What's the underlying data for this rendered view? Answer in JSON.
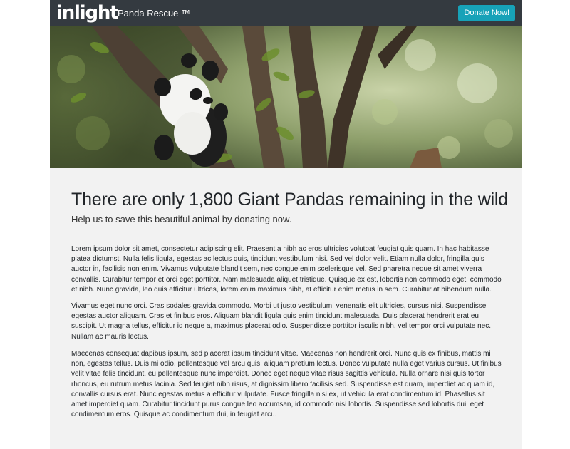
{
  "navbar": {
    "logo_text": "inlight",
    "brand": "Panda Rescue ™",
    "donate_label": "Donate Now!"
  },
  "hero": {
    "image_description": "panda-in-tree"
  },
  "main": {
    "headline": "There are only 1,800 Giant Pandas remaining in the wild",
    "subheadline": "Help us to save this beautiful animal by donating now.",
    "paragraphs": [
      "Lorem ipsum dolor sit amet, consectetur adipiscing elit. Praesent a nibh ac eros ultricies volutpat feugiat quis quam. In hac habitasse platea dictumst. Nulla felis ligula, egestas ac lectus quis, tincidunt vestibulum nisi. Sed vel dolor velit. Etiam nulla dolor, fringilla quis auctor in, facilisis non enim. Vivamus vulputate blandit sem, nec congue enim scelerisque vel. Sed pharetra neque sit amet viverra convallis. Curabitur tempor et orci eget porttitor. Nam malesuada aliquet tristique. Quisque ex est, lobortis non commodo eget, commodo et nibh. Nunc gravida, leo quis efficitur ultrices, lorem enim maximus nibh, at efficitur enim metus in sem. Curabitur at bibendum nulla.",
      "Vivamus eget nunc orci. Cras sodales gravida commodo. Morbi ut justo vestibulum, venenatis elit ultricies, cursus nisi. Suspendisse egestas auctor aliquam. Cras et finibus eros. Aliquam blandit ligula quis enim tincidunt malesuada. Duis placerat hendrerit erat eu suscipit. Ut magna tellus, efficitur id neque a, maximus placerat odio. Suspendisse porttitor iaculis nibh, vel tempor orci vulputate nec. Nullam ac mauris lectus.",
      "Maecenas consequat dapibus ipsum, sed placerat ipsum tincidunt vitae. Maecenas non hendrerit orci. Nunc quis ex finibus, mattis mi non, egestas tellus. Duis mi odio, pellentesque vel arcu quis, aliquam pretium lectus. Donec vulputate nulla eget varius cursus. Ut finibus velit vitae felis tincidunt, eu pellentesque nunc imperdiet. Donec eget neque vitae risus sagittis vehicula. Nulla ornare nisi quis tortor rhoncus, eu rutrum metus lacinia. Sed feugiat nibh risus, at dignissim libero facilisis sed. Suspendisse est quam, imperdiet ac quam id, convallis cursus erat. Nunc egestas metus a efficitur vulputate. Fusce fringilla nisi ex, ut vehicula erat condimentum id. Phasellus sit amet imperdiet quam. Curabitur tincidunt purus congue leo accumsan, id commodo nisi lobortis. Suspendisse sed lobortis dui, eget condimentum eros. Quisque ac condimentum dui, in feugiat arcu."
    ]
  },
  "colors": {
    "navbar_bg": "#343a40",
    "button_bg": "#17a2b8",
    "content_bg": "#f2f2f2"
  }
}
